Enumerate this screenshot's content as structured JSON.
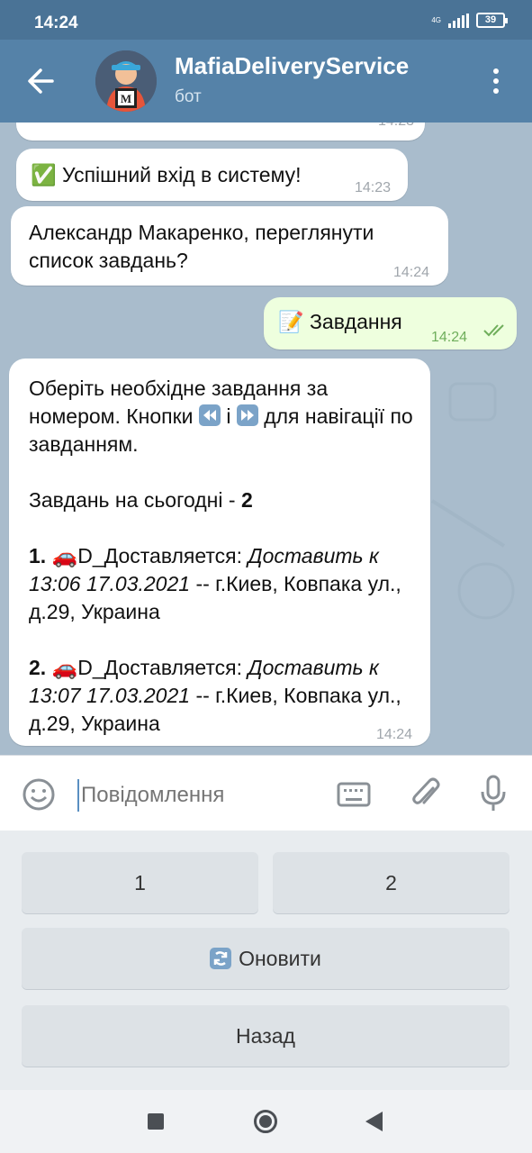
{
  "status_bar": {
    "time": "14:24",
    "network": "4G",
    "battery": "39"
  },
  "header": {
    "title": "MafiaDeliveryService",
    "subtitle": "бот"
  },
  "messages": [
    {
      "time": "14:23"
    },
    {
      "text": "✅ Успішний вхід в систему!",
      "time": "14:23"
    },
    {
      "text": "Александр Макаренко, переглянути список завдань?",
      "time": "14:24"
    },
    {
      "text": "📝 Завдання",
      "time": "14:24"
    },
    {
      "intro1": "Оберіть необхідне завдання за номером. Кнопки",
      "intro_i": "і",
      "intro2": "для навігації по завданням.",
      "count_label": "Завдань на сьогодні -",
      "count": "2",
      "tasks": [
        {
          "num": "1.",
          "status": "D_Доставляется:",
          "deliver": "Доставить к 13:06  17.03.2021",
          "address": "-- г.Киев, Ковпака ул., д.29, Украина"
        },
        {
          "num": "2.",
          "status": "D_Доставляется:",
          "deliver": "Доставить к 13:07  17.03.2021",
          "address": "-- г.Киев, Ковпака ул., д.29, Украина"
        }
      ],
      "time": "14:24"
    }
  ],
  "input": {
    "placeholder": "Повідомлення"
  },
  "keyboard": {
    "btn1": "1",
    "btn2": "2",
    "refresh": "Оновити",
    "back": "Назад"
  },
  "colors": {
    "header": "#5582a8",
    "status_bar": "#4a7396",
    "outgoing": "#eeffde"
  }
}
